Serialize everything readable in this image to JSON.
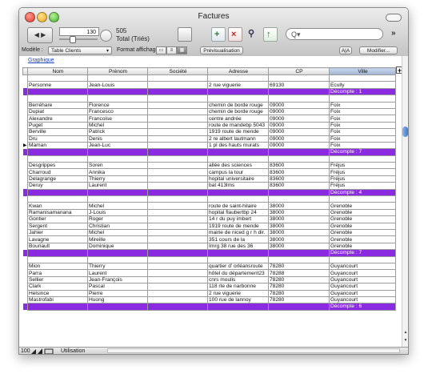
{
  "window": {
    "title": "Factures"
  },
  "toolbar": {
    "record_number": "130",
    "record_count": "505",
    "record_status": "Total (Triés)",
    "search_placeholder": "Q▾",
    "more_label": "»"
  },
  "layout_bar": {
    "layout_label": "Modèle :",
    "layout_value": "Table Clients",
    "format_label": "Format affichage :",
    "preview_button": "Prévisualisation",
    "aa_button": "A|A",
    "modify_button": "Modifier..."
  },
  "content": {
    "graph_link": "Graphique",
    "columns": [
      "Nom",
      "Prénom",
      "Société",
      "Adresse",
      "CP",
      "Ville"
    ],
    "sorted_column": "Ville",
    "current_row_marker": "▶",
    "rows": [
      {
        "type": "blank"
      },
      {
        "type": "data",
        "cells": [
          "Personne",
          "Jean-Louis",
          "",
          "2 rue viguerie",
          "69130",
          "Ecully"
        ]
      },
      {
        "type": "sum",
        "text": "Décompte : 1"
      },
      {
        "type": "blank"
      },
      {
        "type": "data",
        "cells": [
          "Berréhare",
          "Florence",
          "",
          "chemin de borde rouge",
          "09000",
          "Foix"
        ]
      },
      {
        "type": "data",
        "cells": [
          "Dupiat",
          "Francesco",
          "",
          "chemin de borde rouge",
          "09000",
          "Foix"
        ]
      },
      {
        "type": "data",
        "cells": [
          "Alexandre",
          "Francoise",
          "",
          "centre andrée",
          "09000",
          "Foix"
        ]
      },
      {
        "type": "data",
        "cells": [
          "Puget",
          "Michel",
          "",
          "route de mandebp 5043",
          "09000",
          "Foix"
        ]
      },
      {
        "type": "data",
        "cells": [
          "Berville",
          "Patrick",
          "",
          "1919 route de mende",
          "09000",
          "Foix"
        ]
      },
      {
        "type": "data",
        "cells": [
          "Dru",
          "Denis",
          "",
          "2 re albert lautmann",
          "09000",
          "Foix"
        ]
      },
      {
        "type": "data",
        "current": true,
        "cells": [
          "Maman",
          "Jean-Luc",
          "",
          "1 pl des hauts murats",
          "09000",
          "Foix"
        ]
      },
      {
        "type": "sum",
        "text": "Décompte : 7"
      },
      {
        "type": "blank"
      },
      {
        "type": "data",
        "cells": [
          "Desgrippes",
          "Soren",
          "",
          "allée des sciences",
          "83600",
          "Fréjus"
        ]
      },
      {
        "type": "data",
        "cells": [
          "Charroud",
          "Annika",
          "",
          "campus la tour",
          "83600",
          "Fréjus"
        ]
      },
      {
        "type": "data",
        "cells": [
          "Delagrange",
          "Thierry",
          "",
          "hopital universitaire",
          "83600",
          "Fréjus"
        ]
      },
      {
        "type": "data",
        "cells": [
          "Deruy",
          "Laurent",
          "",
          "bat 413lms",
          "83600",
          "Fréjus"
        ]
      },
      {
        "type": "sum",
        "text": "Décompte : 4"
      },
      {
        "type": "blank"
      },
      {
        "type": "data",
        "cells": [
          "Kwan",
          "Michel",
          "",
          "route de saint-hilaire",
          "38000",
          "Grenoble"
        ]
      },
      {
        "type": "data",
        "cells": [
          "Ramanisamanana",
          "J-Louis",
          "",
          "hopital flaubertbp 24",
          "38000",
          "Grenoble"
        ]
      },
      {
        "type": "data",
        "cells": [
          "Gontier",
          "Roger",
          "",
          "14 r du puy imbert",
          "38000",
          "Grenoble"
        ]
      },
      {
        "type": "data",
        "cells": [
          "Sergent",
          "Christian",
          "",
          "1919 route de mende",
          "38000",
          "Grenoble"
        ]
      },
      {
        "type": "data",
        "cells": [
          "Jahier",
          "Michel",
          "",
          "mairie de niced g r h dir.",
          "38000",
          "Grenoble"
        ]
      },
      {
        "type": "data",
        "cells": [
          "Lavagne",
          "Mireille",
          "",
          "351 cours de la",
          "38000",
          "Grenoble"
        ]
      },
      {
        "type": "data",
        "cells": [
          "Bouriault",
          "Dominique",
          "",
          "Imrg 38 rue des 36",
          "38000",
          "Grenoble"
        ]
      },
      {
        "type": "sum",
        "text": "Décompte : 7"
      },
      {
        "type": "blank"
      },
      {
        "type": "data",
        "cells": [
          "Mion",
          "Thierry",
          "",
          "quartier d' orléansroute",
          "78280",
          "Guyancourt"
        ]
      },
      {
        "type": "data",
        "cells": [
          "Parra",
          "Laurent",
          "",
          "hôtel du département23",
          "78288",
          "Guyancourt"
        ]
      },
      {
        "type": "data",
        "cells": [
          "Sellier",
          "Jean-François",
          "",
          "cnrs moulis",
          "78280",
          "Guyancourt"
        ]
      },
      {
        "type": "data",
        "cells": [
          "Clark",
          "Pascal",
          "",
          "118 rte de narbonne",
          "78280",
          "Guyancourt"
        ]
      },
      {
        "type": "data",
        "cells": [
          "Helsince",
          "Pierre",
          "",
          "2 rue viguerie",
          "78280",
          "Guyancourt"
        ]
      },
      {
        "type": "data",
        "cells": [
          "Mastrofabi",
          "Huong",
          "",
          "100 rue de lannoy",
          "78280",
          "Guyancourt"
        ]
      },
      {
        "type": "sum",
        "text": "Décompte : 6"
      }
    ]
  },
  "status_bar": {
    "zoom": "100",
    "mode": "Utilisation"
  },
  "colors": {
    "summary_row": "#8a2be2",
    "link": "#1a44c0",
    "scroll_thumb": "#3f78c9"
  }
}
